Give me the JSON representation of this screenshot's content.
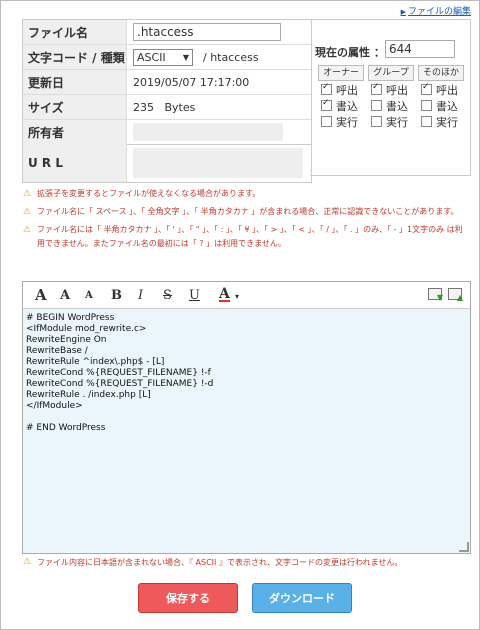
{
  "header": {
    "edit_link": "ファイルの編集"
  },
  "info": {
    "filename_label": "ファイル名",
    "filename_value": ".htaccess",
    "charset_label": "文字コード / 種類",
    "charset_value": "ASCII",
    "type_value": "/ htaccess",
    "updated_label": "更新日",
    "updated_value": "2019/05/07 17:17:00",
    "size_label": "サイズ",
    "size_value": "235   Bytes",
    "owner_label": "所有者",
    "url_label": "U R L"
  },
  "perm": {
    "title": "現在の属性 ：",
    "value": "644",
    "owner": {
      "label": "オーナー",
      "read": "呼出",
      "write": "書込",
      "exec": "実行",
      "checked": [
        true,
        true,
        false
      ]
    },
    "group": {
      "label": "グループ",
      "read": "呼出",
      "write": "書込",
      "exec": "実行",
      "checked": [
        true,
        false,
        false
      ]
    },
    "other": {
      "label": "そのほか",
      "read": "呼出",
      "write": "書込",
      "exec": "実行",
      "checked": [
        true,
        false,
        false
      ]
    }
  },
  "warnings": [
    "拡張子を変更するとファイルが使えなくなる場合があります。",
    "ファイル名に「 スペース 」、「 全角文字 」、「 半角カタカナ 」が含まれる場合、正常に認識できないことがあります。",
    "ファイル名には「 半角カタカナ 」、「 ' 」、「 \" 」、「 : 」、「 ¥ 」、「 > 」、「 < 」、「 / 」、「 . 」のみ、「 - 」1文字のみ は利用できません。またファイル名の最初には「 ? 」は利用できません。"
  ],
  "editor": {
    "content": "# BEGIN WordPress\n<IfModule mod_rewrite.c>\nRewriteEngine On\nRewriteBase /\nRewriteRule ^index\\.php$ - [L]\nRewriteCond %{REQUEST_FILENAME} !-f\nRewriteCond %{REQUEST_FILENAME} !-d\nRewriteRule . /index.php [L]\n</IfModule>\n\n# END WordPress"
  },
  "bottom_warning": "ファイル内容に日本語が含まれない場合、『 ASCII 』で表示され、文字コードの変更は行われません。",
  "buttons": {
    "save": "保存する",
    "download": "ダウンロード"
  },
  "colors": {
    "save": "#f0595b",
    "download": "#5ab0e8",
    "warning_text": "#c0392b"
  }
}
